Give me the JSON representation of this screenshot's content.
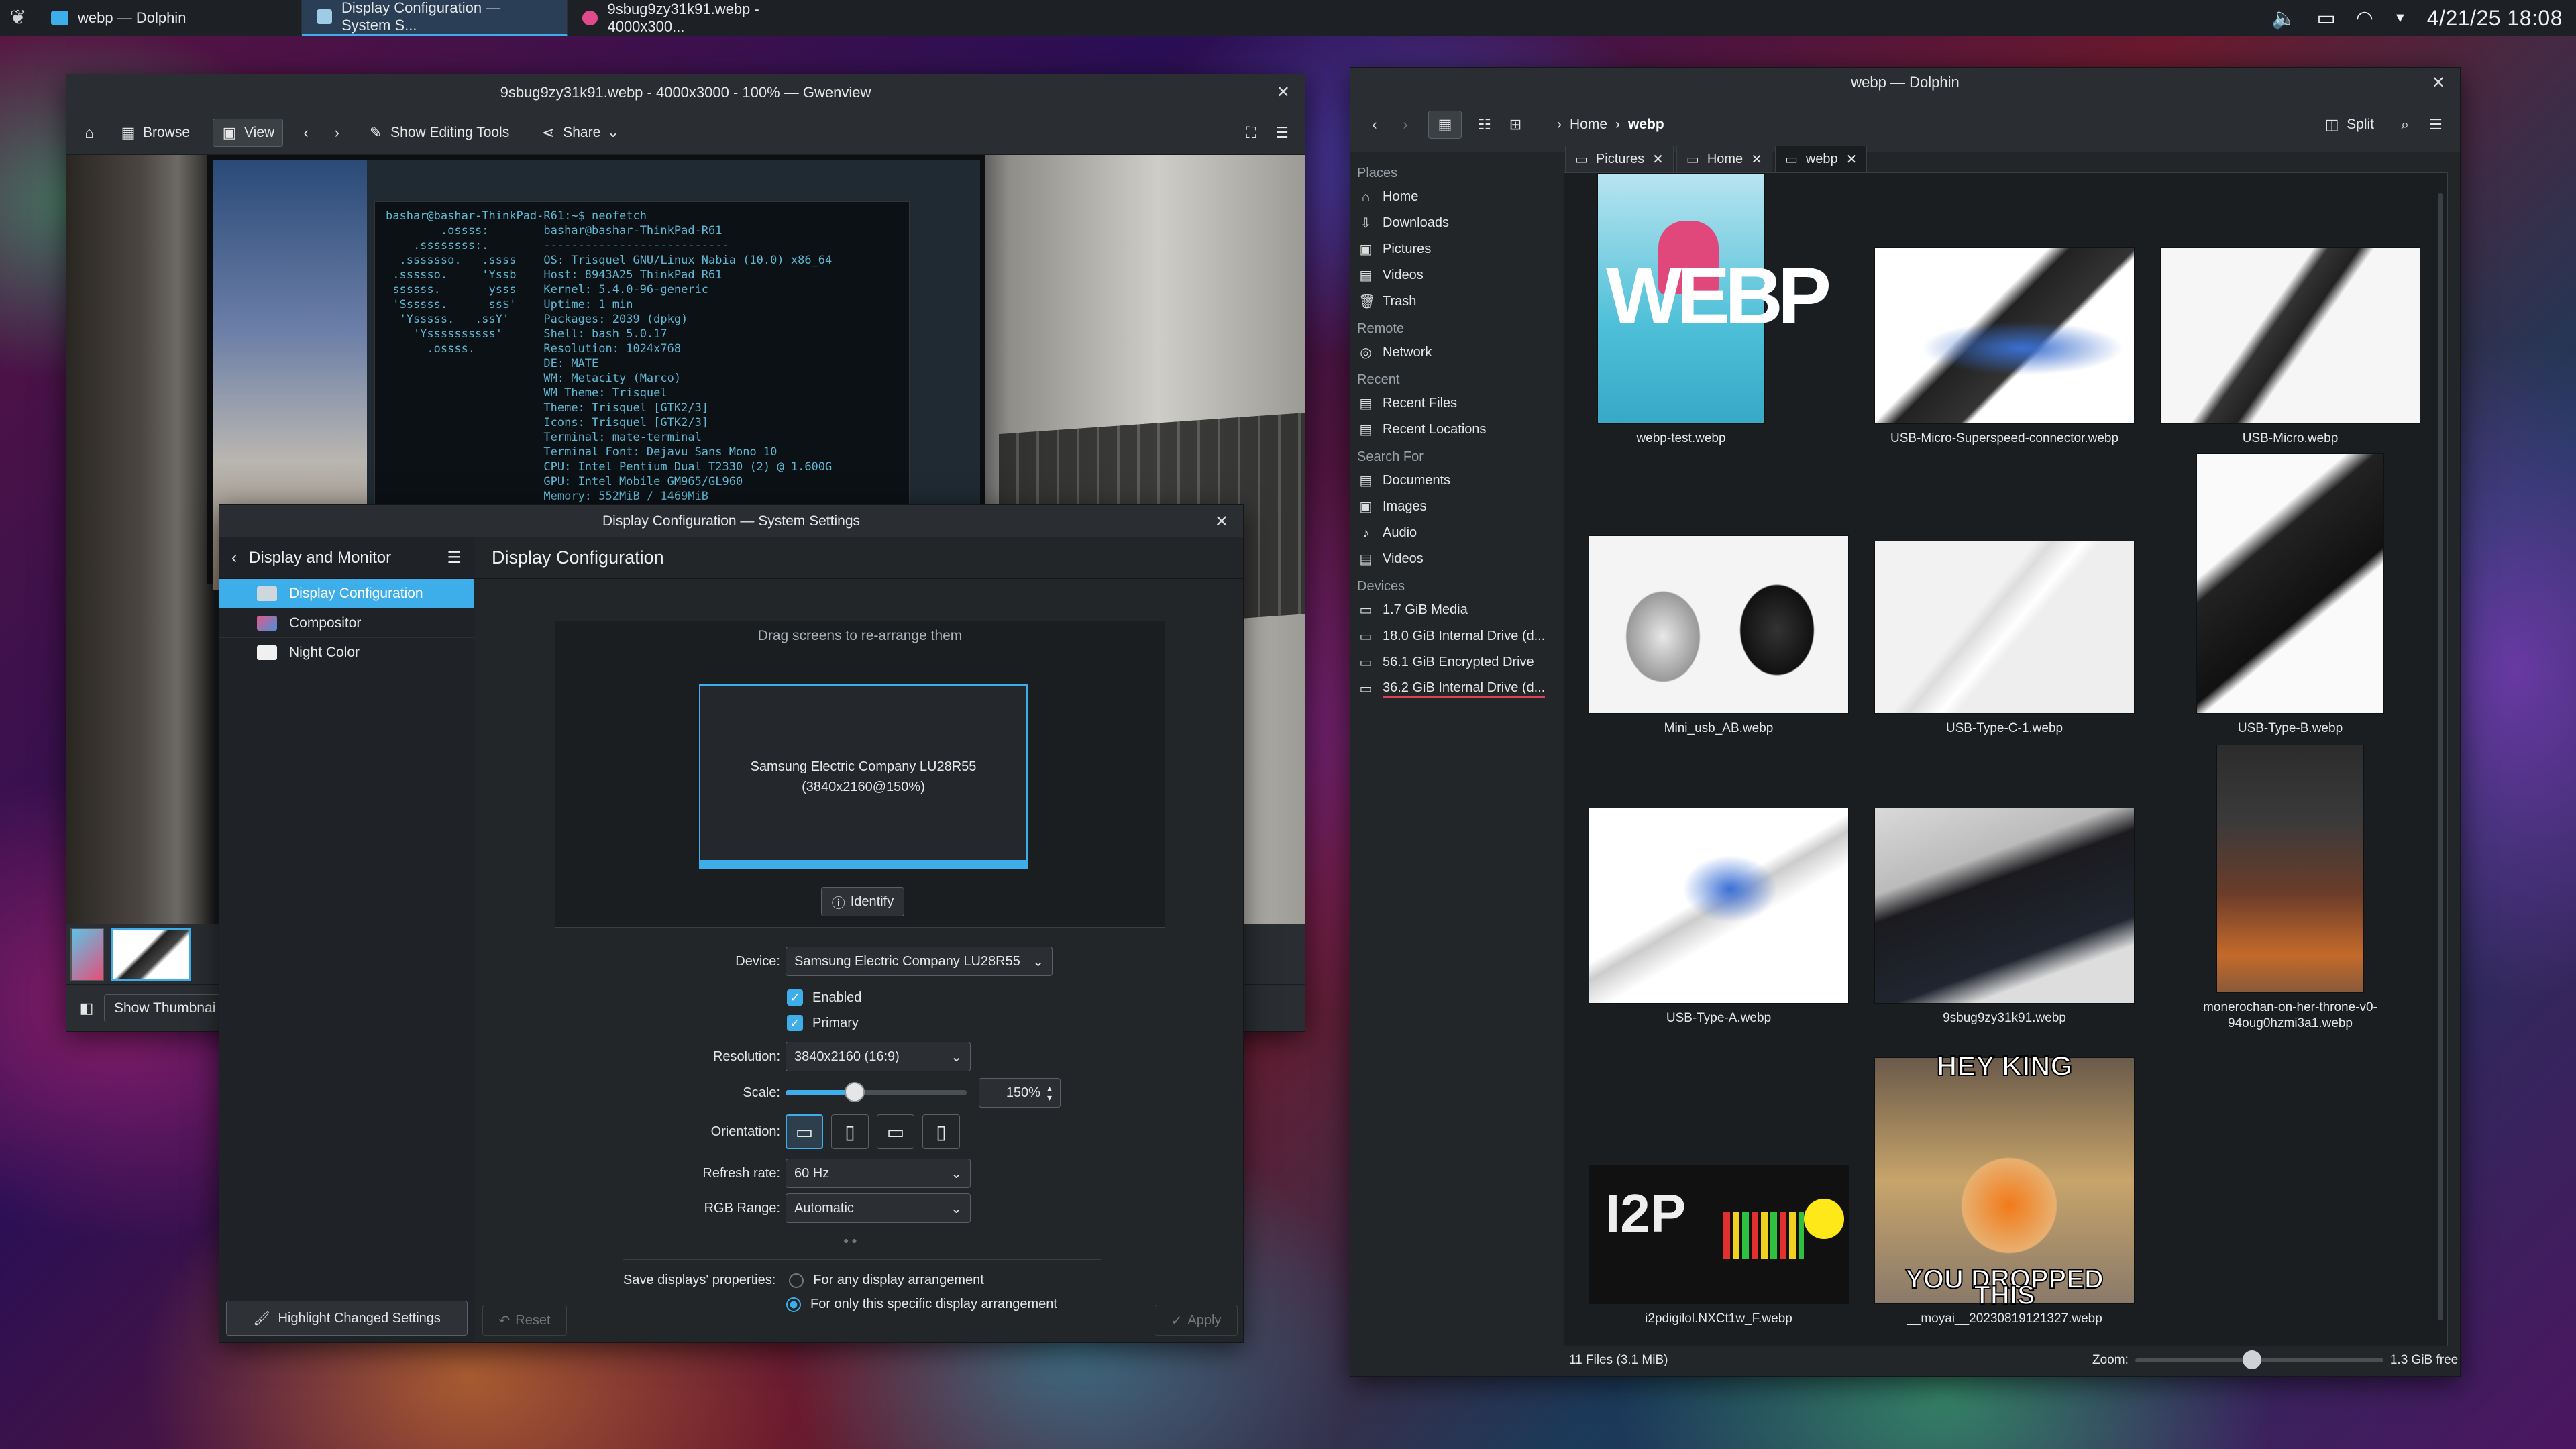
{
  "taskbar": {
    "tasks": [
      {
        "label": "webp — Dolphin"
      },
      {
        "label": "Display Configuration — System S..."
      },
      {
        "label": "9sbug9zy31k91.webp - 4000x300..."
      }
    ],
    "clock": "4/21/25 18:08"
  },
  "gwenview": {
    "title": "9sbug9zy31k91.webp - 4000x3000 - 100% — Gwenview",
    "toolbar": {
      "browse": "Browse",
      "view": "View",
      "editing": "Show Editing Tools",
      "share": "Share"
    },
    "show_thumbnails": "Show Thumbnai",
    "terminal_lines": [
      "bashar@bashar-ThinkPad-R61:~$ neofetch",
      "        .ossss:        bashar@bashar-ThinkPad-R61",
      "    .ssssssss:.        ---------------------------",
      "  .sssssso.   .ssss    OS: Trisquel GNU/Linux Nabia (10.0) x86_64",
      " .ssssso.     'Yssb    Host: 8943A25 ThinkPad R61",
      " ssssss.       ysss    Kernel: 5.4.0-96-generic",
      " 'Ssssss.      ss$'    Uptime: 1 min",
      "  'Ysssss.   .ssY'     Packages: 2039 (dpkg)",
      "    'Yssssssssss'      Shell: bash 5.0.17",
      "      .ossss.          Resolution: 1024x768",
      "                       DE: MATE",
      "                       WM: Metacity (Marco)",
      "                       WM Theme: Trisquel",
      "                       Theme: Trisquel [GTK2/3]",
      "                       Icons: Trisquel [GTK2/3]",
      "                       Terminal: mate-terminal",
      "                       Terminal Font: Dejavu Sans Mono 10",
      "                       CPU: Intel Pentium Dual T2330 (2) @ 1.600G",
      "                       GPU: Intel Mobile GM965/GL960",
      "                       Memory: 552MiB / 1469MiB"
    ]
  },
  "settings": {
    "title": "Display Configuration — System Settings",
    "sidebar": {
      "header": "Display and Monitor",
      "items": [
        "Display Configuration",
        "Compositor",
        "Night Color"
      ]
    },
    "page_title": "Display Configuration",
    "hint": "Drag screens to re-arrange them",
    "monitor": {
      "name": "Samsung Electric Company LU28R55",
      "mode": "(3840x2160@150%)"
    },
    "identify": "Identify",
    "device": {
      "label": "Device:",
      "value": "Samsung Electric Company LU28R55"
    },
    "enabled": "Enabled",
    "primary": "Primary",
    "resolution": {
      "label": "Resolution:",
      "value": "3840x2160 (16:9)"
    },
    "scale": {
      "label": "Scale:",
      "value": "150%",
      "fraction": 0.38
    },
    "orientation": {
      "label": "Orientation:"
    },
    "refresh": {
      "label": "Refresh rate:",
      "value": "60 Hz"
    },
    "rgb": {
      "label": "RGB Range:",
      "value": "Automatic"
    },
    "save": {
      "label": "Save displays' properties:",
      "opt_any": "For any display arrangement",
      "opt_specific": "For only this specific display arrangement"
    },
    "buttons": {
      "highlight": "Highlight Changed Settings",
      "reset": "Reset",
      "apply": "Apply"
    }
  },
  "dolphin": {
    "title": "webp — Dolphin",
    "breadcrumb": {
      "home": "Home",
      "current": "webp"
    },
    "split": "Split",
    "tabs": [
      "Pictures",
      "Home",
      "webp"
    ],
    "places": {
      "places_header": "Places",
      "places_items": [
        "Home",
        "Downloads",
        "Pictures",
        "Videos",
        "Trash"
      ],
      "remote_header": "Remote",
      "remote_items": [
        "Network"
      ],
      "recent_header": "Recent",
      "recent_items": [
        "Recent Files",
        "Recent Locations"
      ],
      "search_header": "Search For",
      "search_items": [
        "Documents",
        "Images",
        "Audio",
        "Videos"
      ],
      "devices_header": "Devices",
      "devices_items": [
        "1.7 GiB Media",
        "18.0 GiB Internal Drive (d...",
        "56.1 GiB Encrypted Drive",
        "36.2 GiB Internal Drive (d..."
      ]
    },
    "files": [
      "webp-test.webp",
      "USB-Micro-Superspeed-connector.webp",
      "USB-Micro.webp",
      "Mini_usb_AB.webp",
      "USB-Type-C-1.webp",
      "USB-Type-B.webp",
      "USB-Type-A.webp",
      "9sbug9zy31k91.webp",
      "monerochan-on-her-throne-v0-94oug0hzmi3a1.webp",
      "i2pdigilol.NXCt1w_F.webp",
      "__moyai__20230819121327.webp"
    ],
    "image_text": {
      "webp": "WEBP",
      "i2p": "I2P",
      "meme_top": "HEY KING",
      "meme_bottom": "YOU DROPPED THIS"
    },
    "status": {
      "count": "11 Files (3.1 MiB)",
      "zoom": "Zoom:",
      "free": "1.3 GiB free"
    }
  }
}
